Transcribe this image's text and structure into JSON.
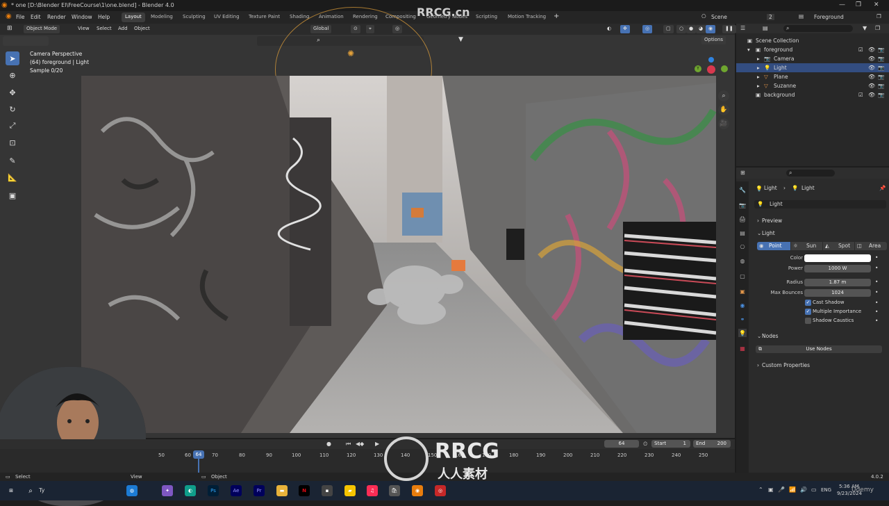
{
  "titlebar": {
    "title": "* one [D:\\Blender El\\FreeCourse\\1\\one.blend] - Blender 4.0"
  },
  "menubar": {
    "items": [
      "File",
      "Edit",
      "Render",
      "Window",
      "Help"
    ],
    "workspaces": [
      "Layout",
      "Modeling",
      "Sculpting",
      "UV Editing",
      "Texture Paint",
      "Shading",
      "Animation",
      "Rendering",
      "Compositing",
      "Geometry Nodes",
      "Scripting",
      "Motion Tracking"
    ],
    "active_workspace": "Layout",
    "scene_label": "Scene",
    "scene_count": "2",
    "view_layer": "Foreground"
  },
  "viewport_header": {
    "mode": "Object Mode",
    "menus": [
      "View",
      "Select",
      "Add",
      "Object"
    ],
    "transform": "Global",
    "options": "Options"
  },
  "viewport_overlay": {
    "line1": "Camera Perspective",
    "line2": "(64) foreground | Light",
    "line3": "Sample 0/20"
  },
  "outliner": {
    "root": "Scene Collection",
    "rows": [
      {
        "label": "foreground"
      },
      {
        "label": "Camera"
      },
      {
        "label": "Light"
      },
      {
        "label": "Plane"
      },
      {
        "label": "Suzanne"
      },
      {
        "label": "background"
      }
    ]
  },
  "properties": {
    "breadcrumb_a": "Light",
    "breadcrumb_b": "Light",
    "datablock": "Light",
    "preview": "Preview",
    "light_section": "Light",
    "types": [
      "Point",
      "Sun",
      "Spot",
      "Area"
    ],
    "active_type": "Point",
    "color_label": "Color",
    "color_value": "#ffffff",
    "power_label": "Power",
    "power_value": "1000 W",
    "radius_label": "Radius",
    "radius_value": "1.87 m",
    "bounces_label": "Max Bounces",
    "bounces_value": "1024",
    "cast_shadow": "Cast Shadow",
    "multiple_importance": "Multiple Importance",
    "shadow_caustics": "Shadow Caustics",
    "nodes": "Nodes",
    "use_nodes": "Use Nodes",
    "custom_props": "Custom Properties"
  },
  "timeline": {
    "current_frame": "64",
    "start_label": "Start",
    "start": "1",
    "end_label": "End",
    "end": "200",
    "ticks": [
      "50",
      "60",
      "70",
      "80",
      "90",
      "100",
      "110",
      "120",
      "130",
      "140",
      "150",
      "160",
      "170",
      "180",
      "190",
      "200",
      "210",
      "220",
      "230",
      "240",
      "250"
    ]
  },
  "status": {
    "left": "Select",
    "mid": "Object",
    "mid2": "View",
    "version": "4.0.2"
  },
  "taskbar": {
    "lang": "ENG",
    "time": "5:36 AM",
    "date": "9/23/2024",
    "search": "Ty"
  },
  "watermark": {
    "brand": "RRCG",
    "domain": "RRCG.cn",
    "cn": "人人素材",
    "udemy": "Udemy"
  },
  "colors": {
    "accent": "#4772b3",
    "selected_row": "#334d80",
    "frame_marker": "#4772b3"
  }
}
